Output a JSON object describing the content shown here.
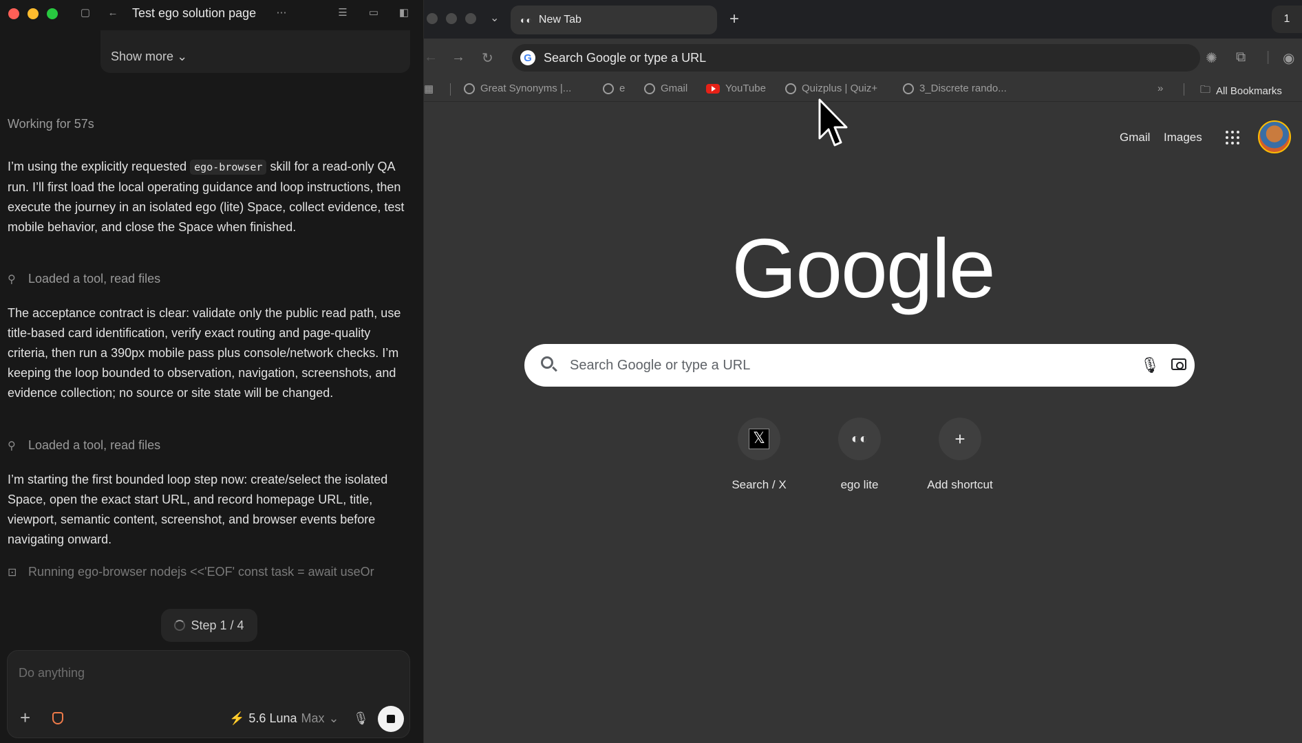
{
  "agent": {
    "window_title": "Test ego solution page",
    "show_more": "Show more",
    "working": "Working for 57s",
    "para1_a": "I’m using the explicitly requested ",
    "para1_code": "ego-browser",
    "para1_b": " skill for a read-only QA run. I’ll first load the local operating guidance and loop instructions, then execute the journey in an isolated ego (lite) Space, collect evidence, test mobile behavior, and close the Space when finished.",
    "tool1": "Loaded a tool, read files",
    "para2": "The acceptance contract is clear: validate only the public read path, use title-based card identification, verify exact routing and page-quality criteria, then run a 390px mobile pass plus console/network checks. I’m keeping the loop bounded to observation, navigation, screenshots, and evidence collection; no source or site state will be changed.",
    "tool2": "Loaded a tool, read files",
    "para3": "I’m starting the first bounded loop step now: create/select the isolated Space, open the exact start URL, and record homepage URL, title, viewport, semantic content, screenshot, and browser events before navigating onward.",
    "running": "Running ego-browser nodejs <<'EOF' const task = await useOr",
    "step": "Step 1 / 4",
    "composer_placeholder": "Do anything",
    "model_name": "5.6 Luna",
    "model_mode": "Max"
  },
  "browser": {
    "tab_title": "New Tab",
    "profile_count": "1",
    "omnibox": "Search Google or type a URL",
    "bookmarks": [
      "Great Synonyms |...",
      "e",
      "Gmail",
      "YouTube",
      "Quizplus | Quiz+",
      "3_Discrete rando..."
    ],
    "all_bookmarks": "All Bookmarks",
    "overflow": "»"
  },
  "ntp": {
    "gmail": "Gmail",
    "images": "Images",
    "logo": "Google",
    "search_placeholder": "Search Google or type a URL",
    "shortcuts": [
      "Search / X",
      "ego lite",
      "Add shortcut"
    ]
  }
}
